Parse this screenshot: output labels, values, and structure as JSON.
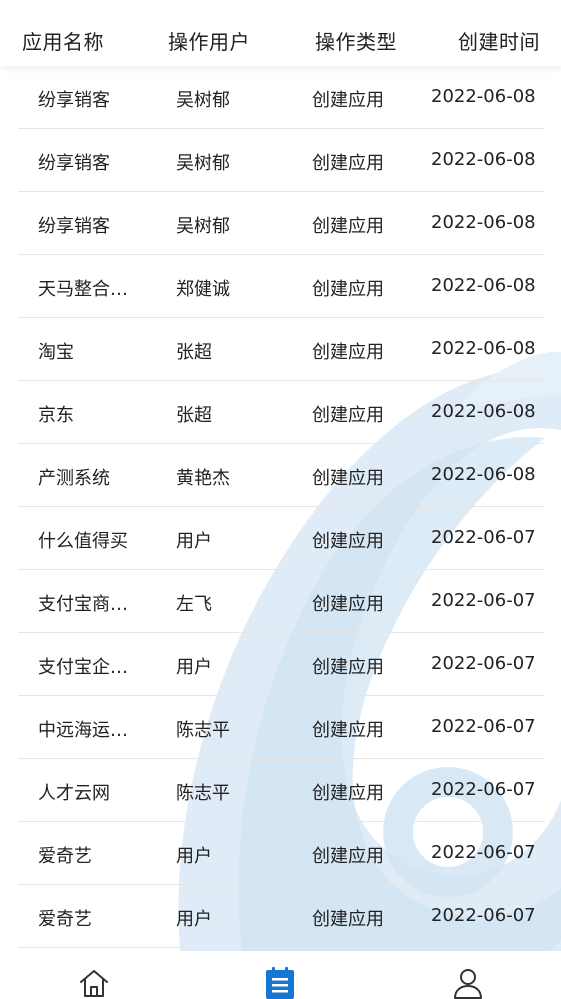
{
  "table": {
    "headers": {
      "app": "应用名称",
      "user": "操作用户",
      "type": "操作类型",
      "time": "创建时间"
    },
    "rows": [
      {
        "app": "纷享销客",
        "user": "吴树郁",
        "type": "创建应用",
        "time": "2022-06-08"
      },
      {
        "app": "纷享销客",
        "user": "吴树郁",
        "type": "创建应用",
        "time": "2022-06-08"
      },
      {
        "app": "纷享销客",
        "user": "吴树郁",
        "type": "创建应用",
        "time": "2022-06-08"
      },
      {
        "app": "天马整合…",
        "user": "郑健诚",
        "type": "创建应用",
        "time": "2022-06-08"
      },
      {
        "app": "淘宝",
        "user": "张超",
        "type": "创建应用",
        "time": "2022-06-08"
      },
      {
        "app": "京东",
        "user": "张超",
        "type": "创建应用",
        "time": "2022-06-08"
      },
      {
        "app": "产测系统",
        "user": "黄艳杰",
        "type": "创建应用",
        "time": "2022-06-08"
      },
      {
        "app": "什么值得买",
        "user": "用户",
        "type": "创建应用",
        "time": "2022-06-07"
      },
      {
        "app": "支付宝商…",
        "user": "左飞",
        "type": "创建应用",
        "time": "2022-06-07"
      },
      {
        "app": "支付宝企…",
        "user": "用户",
        "type": "创建应用",
        "time": "2022-06-07"
      },
      {
        "app": "中远海运…",
        "user": "陈志平",
        "type": "创建应用",
        "time": "2022-06-07"
      },
      {
        "app": "人才云网",
        "user": "陈志平",
        "type": "创建应用",
        "time": "2022-06-07"
      },
      {
        "app": "爱奇艺",
        "user": "用户",
        "type": "创建应用",
        "time": "2022-06-07"
      },
      {
        "app": "爱奇艺",
        "user": "用户",
        "type": "创建应用",
        "time": "2022-06-07"
      }
    ]
  },
  "bottom_nav": {
    "items": [
      {
        "icon": "home-icon",
        "active": false
      },
      {
        "icon": "list-icon",
        "active": true
      },
      {
        "icon": "user-icon",
        "active": false
      }
    ]
  },
  "colors": {
    "accent": "#1677d2",
    "watermark": "#dbe9f5",
    "divider": "#e6e6e6",
    "icon_inactive": "#333333"
  }
}
